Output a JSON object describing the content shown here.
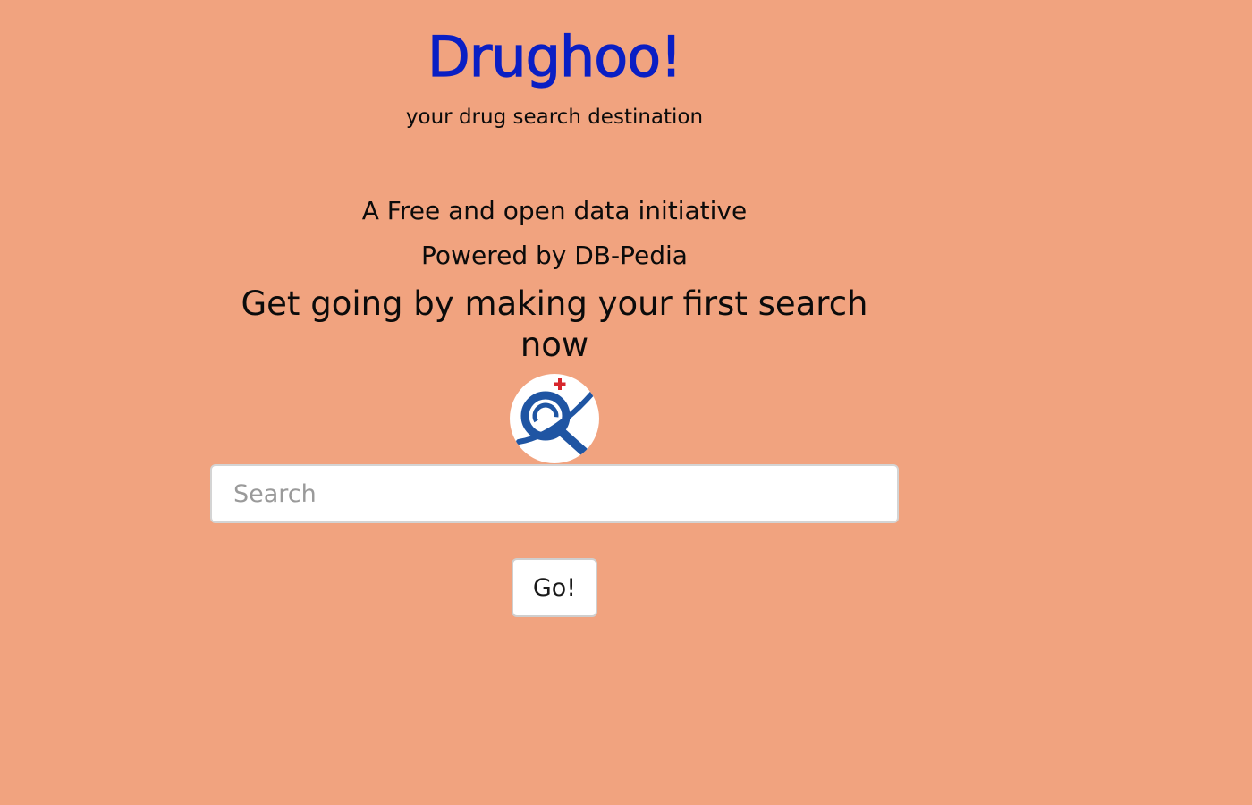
{
  "header": {
    "title": "Drughoo!",
    "tagline": "your drug search destination"
  },
  "intro": {
    "initiative": "A Free and open data initiative",
    "powered_by": "Powered by DB-Pedia",
    "call_to_action": "Get going by making your first search now"
  },
  "logo": {
    "icon": "magnifier-with-medical-cross-icon"
  },
  "search": {
    "placeholder": "Search",
    "value": "",
    "button_label": "Go!"
  },
  "colors": {
    "background": "#f1a37f",
    "title": "#0a1fc4",
    "logo_blue": "#1f55a3",
    "logo_cross": "#d7262c"
  }
}
